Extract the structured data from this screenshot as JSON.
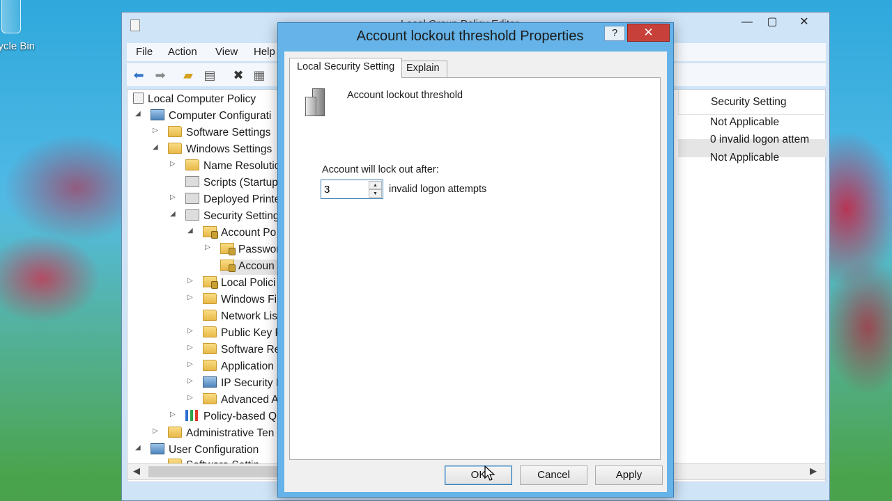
{
  "desktop": {
    "recycle_bin_label": "cycle Bin"
  },
  "mmc": {
    "title": "Local Group Policy Editor",
    "menu": [
      "File",
      "Action",
      "View",
      "Help"
    ],
    "tree": [
      {
        "label": "Local Computer Policy"
      },
      {
        "label": "Computer Configurati"
      },
      {
        "label": "Software Settings"
      },
      {
        "label": "Windows Settings"
      },
      {
        "label": "Name Resolutio"
      },
      {
        "label": "Scripts (Startup"
      },
      {
        "label": "Deployed Printe"
      },
      {
        "label": "Security Setting"
      },
      {
        "label": "Account Po"
      },
      {
        "label": "Passwor"
      },
      {
        "label": "Accoun"
      },
      {
        "label": "Local Polici"
      },
      {
        "label": "Windows Fi"
      },
      {
        "label": "Network Lis"
      },
      {
        "label": "Public Key P"
      },
      {
        "label": "Software Re"
      },
      {
        "label": "Application"
      },
      {
        "label": "IP Security P"
      },
      {
        "label": "Advanced A"
      },
      {
        "label": "Policy-based Q"
      },
      {
        "label": "Administrative Ten"
      },
      {
        "label": "User Configuration"
      },
      {
        "label": "Software Settin"
      }
    ],
    "column_header": "Security Setting",
    "values": [
      "Not Applicable",
      "0 invalid logon attem",
      "Not Applicable"
    ]
  },
  "dialog": {
    "title": "Account lockout threshold Properties",
    "help_label": "?",
    "close_label": "✕",
    "tabs": [
      "Local Security Setting",
      "Explain"
    ],
    "policy_name": "Account lockout threshold",
    "lockout_label": "Account will lock out after:",
    "threshold_value": "3",
    "attempts_label": "invalid logon attempts",
    "ok_label": "OK",
    "cancel_label": "Cancel",
    "apply_label": "Apply"
  }
}
